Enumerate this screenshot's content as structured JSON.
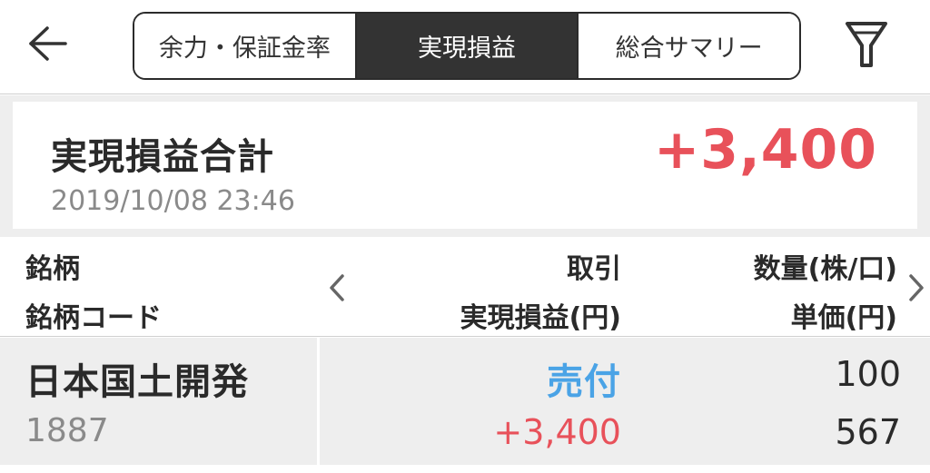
{
  "header": {
    "tabs": [
      {
        "label": "余力・保証金率",
        "active": false
      },
      {
        "label": "実現損益",
        "active": true
      },
      {
        "label": "総合サマリー",
        "active": false
      }
    ],
    "back_icon": "arrow-left-icon",
    "filter_icon": "filter-icon"
  },
  "summary": {
    "title": "実現損益合計",
    "timestamp": "2019/10/08 23:46",
    "total": "+3,400"
  },
  "columns": {
    "name": "銘柄",
    "code": "銘柄コード",
    "trade": "取引",
    "realized_pl": "実現損益(円)",
    "quantity": "数量(株/口)",
    "unit_price": "単価(円)"
  },
  "rows": [
    {
      "name": "日本国土開発",
      "code": "1887",
      "trade": "売付",
      "realized_pl": "+3,400",
      "quantity": "100",
      "unit_price": "567"
    }
  ],
  "colors": {
    "positive": "#e8515a",
    "sell": "#4aa3e6",
    "active_tab_bg": "#333333"
  }
}
